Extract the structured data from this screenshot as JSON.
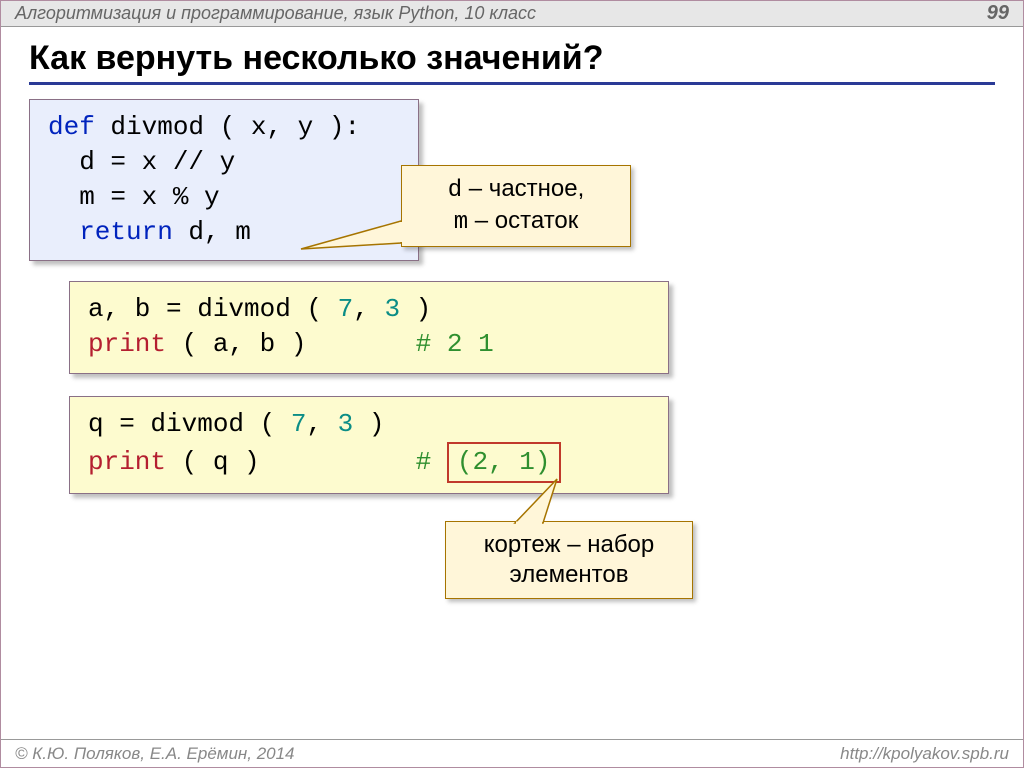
{
  "header": {
    "subtitle": "Алгоритмизация и программирование, язык Python, 10 класс",
    "page": "99"
  },
  "title": "Как вернуть несколько значений?",
  "code1": {
    "l1a": "def",
    "l1b": " divmod ( x, y ):",
    "l2": "  d = x // y",
    "l3": "  m = x % y",
    "l4a": "  return",
    "l4b": " d, m"
  },
  "callout1": {
    "line1a": "d",
    "line1b": " – частное,",
    "line2a": "m",
    "line2b": " – остаток"
  },
  "code2": {
    "l1a": "a, b = divmod ( ",
    "l1n1": "7",
    "l1c": ", ",
    "l1n2": "3",
    "l1d": " )",
    "l2a": "print",
    "l2b": " ( a, b )       ",
    "l2c": "# 2 1"
  },
  "code3": {
    "l1a": "q = divmod ( ",
    "l1n1": "7",
    "l1c": ", ",
    "l1n2": "3",
    "l1d": " )",
    "l2a": "print",
    "l2b": " ( q )          ",
    "l2c": "# ",
    "redbox": "(2, 1)"
  },
  "callout2": {
    "line1": "кортеж – набор",
    "line2": "элементов"
  },
  "footer": {
    "left": "© К.Ю. Поляков, Е.А. Ерёмин, 2014",
    "right": "http://kpolyakov.spb.ru"
  }
}
